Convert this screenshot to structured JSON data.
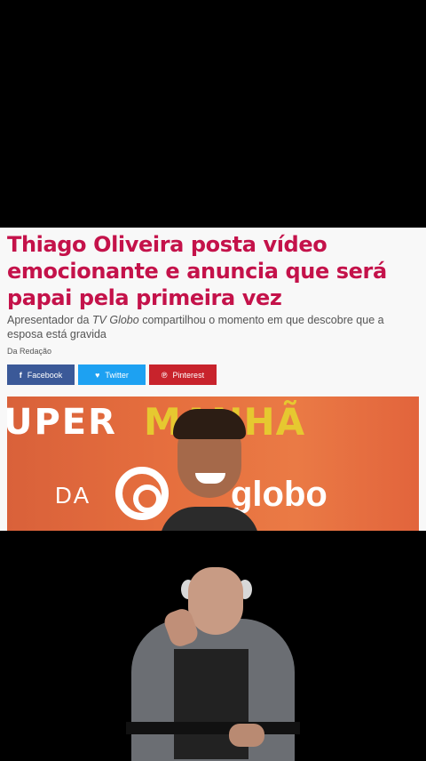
{
  "article": {
    "headline": "Thiago Oliveira posta vídeo emocionante e anuncia que será papai pela primeira vez",
    "subtitle_before": "Apresentador da ",
    "subtitle_em": "TV Globo",
    "subtitle_after": " compartilhou o momento em que descobre que a esposa está gravida",
    "byline": "Da Redação"
  },
  "share": {
    "facebook": {
      "label": "Facebook",
      "icon": "f",
      "color": "#3b5998"
    },
    "twitter": {
      "label": "Twitter",
      "icon": "♥",
      "color": "#1da1f2"
    },
    "pinterest": {
      "label": "Pinterest",
      "icon": "℗",
      "color": "#c8232c"
    }
  },
  "photo": {
    "upper_text": "UPER",
    "manha_text": "MANHÃ",
    "da_text": "DA",
    "globo_text": "globo"
  }
}
